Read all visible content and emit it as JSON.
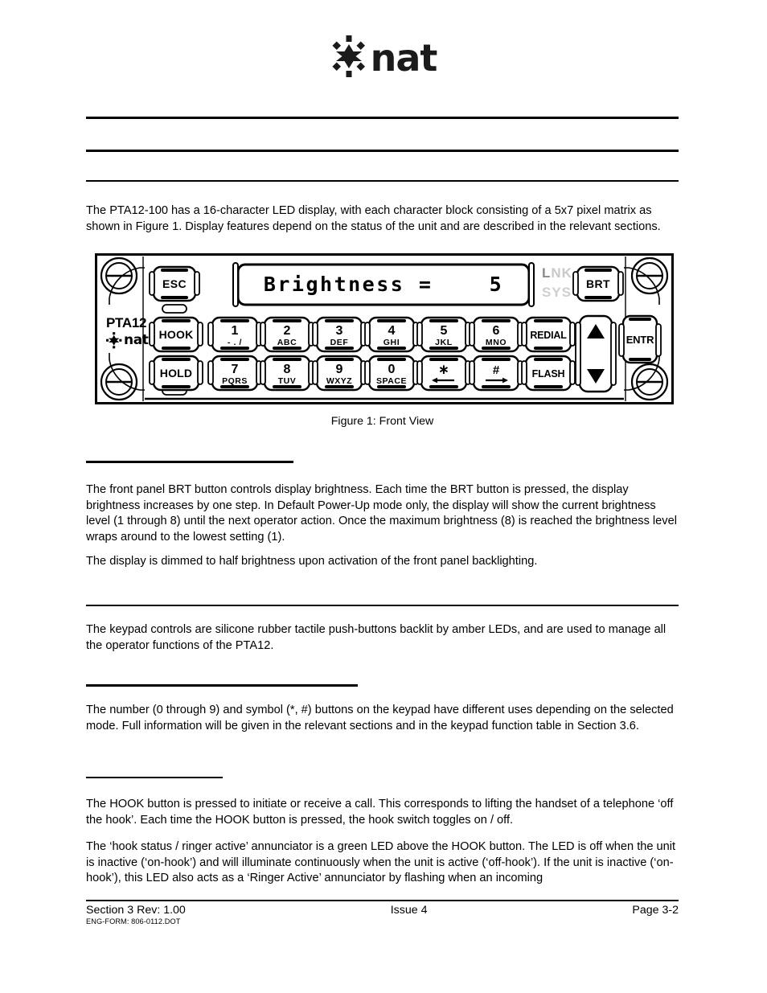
{
  "header": {
    "logo_text": "nat",
    "logo_mark": "starburst-asterisk"
  },
  "sections": {
    "display_intro": "The PTA12-100 has a 16-character LED display, with each character block consisting of a 5x7 pixel matrix as shown in Figure 1. Display features depend on the status of the unit and are described in the relevant sections.",
    "brightness_para": "The front panel BRT button controls display brightness. Each time the BRT button is pressed, the display brightness increases by one step. In Default Power-Up mode only, the display will show the current brightness level (1 through 8) until the next operator action. Once the maximum brightness (8) is reached the brightness level wraps around to the lowest setting (1).",
    "dimmed_para": "The display is dimmed to half brightness upon activation of the front panel backlighting.",
    "keypad_para": "The keypad controls are silicone rubber tactile push-buttons backlit by amber LEDs, and are used to manage all the operator functions of the PTA12.",
    "number_keys_para": "The number (0 through 9) and symbol (*, #) buttons on the keypad have different uses depending on the selected mode. Full information will be given in the relevant sections and in the keypad function table in Section 3.6.",
    "hook_para": "The HOOK button is pressed to initiate or receive a call. This corresponds to lifting the handset of a telephone ‘off the hook’. Each time the HOOK button is pressed, the hook switch toggles on / off.",
    "annunciator_para": "The ‘hook status / ringer active’ annunciator is a green LED above the HOOK button. The LED is off when the unit is inactive (‘on-hook’) and will illuminate continuously when the unit is active (‘off-hook’). If the unit is inactive (‘on-hook’), this LED also acts as a ‘Ringer Active’ annunciator by flashing when an incoming"
  },
  "figure": {
    "caption": "Figure 1: Front View",
    "device_label": "PTA12",
    "device_brand": "nat",
    "display_text": "Brightness =    5",
    "indicators": [
      {
        "label": "LNK"
      },
      {
        "label": "SYS"
      }
    ],
    "keys": {
      "esc": "ESC",
      "brt": "BRT",
      "hook": "HOOK",
      "hold": "HOLD",
      "redial": "REDIAL",
      "flash": "FLASH",
      "entr": "ENTR",
      "up": "▲",
      "down": "▼"
    },
    "keypad_rows": [
      [
        {
          "digit": "1",
          "letters": "- . /"
        },
        {
          "digit": "2",
          "letters": "A B C"
        },
        {
          "digit": "3",
          "letters": "D E F"
        },
        {
          "digit": "4",
          "letters": "G H I"
        },
        {
          "digit": "5",
          "letters": "J K L"
        },
        {
          "digit": "6",
          "letters": "M N O"
        }
      ],
      [
        {
          "digit": "7",
          "letters": "P Q R S"
        },
        {
          "digit": "8",
          "letters": "T U V"
        },
        {
          "digit": "9",
          "letters": "W X Y Z"
        },
        {
          "digit": "0",
          "letters": "SPACE"
        },
        {
          "digit": "∗",
          "letters": "arrow-left"
        },
        {
          "digit": "#",
          "letters": "arrow-right"
        }
      ]
    ]
  },
  "footer": {
    "left": "Section 3 Rev: 1.00",
    "left_sub": "ENG-FORM: 806-0112.DOT",
    "middle": "Issue 4",
    "right": "Page 3-2"
  },
  "colors": {
    "text": "#000000",
    "indicator_grey": "#c9c9c9",
    "indicator_dark": "#8a8a8a",
    "page_bg": "#ffffff"
  }
}
